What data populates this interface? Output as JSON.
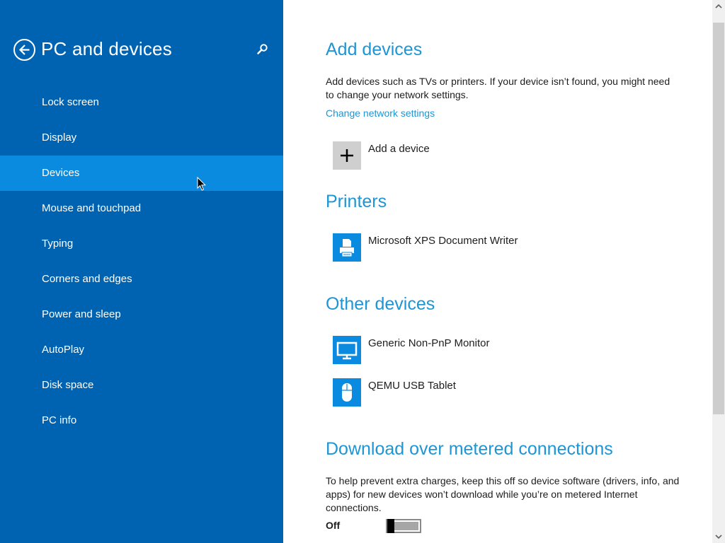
{
  "sidebar": {
    "title": "PC and devices",
    "items": [
      {
        "label": "Lock screen"
      },
      {
        "label": "Display"
      },
      {
        "label": "Devices"
      },
      {
        "label": "Mouse and touchpad"
      },
      {
        "label": "Typing"
      },
      {
        "label": "Corners and edges"
      },
      {
        "label": "Power and sleep"
      },
      {
        "label": "AutoPlay"
      },
      {
        "label": "Disk space"
      },
      {
        "label": "PC info"
      }
    ],
    "selected_item": "Devices",
    "background_color": "#0063b1",
    "selected_color": "#0a8be0"
  },
  "add_devices": {
    "title": "Add devices",
    "description": "Add devices such as TVs or printers. If your device isn’t found, you might need to change your network settings.",
    "link": "Change network settings",
    "add_button_label": "Add a device"
  },
  "printers": {
    "title": "Printers",
    "items": [
      {
        "label": "Microsoft XPS Document Writer",
        "icon": "printer-icon"
      }
    ]
  },
  "other_devices": {
    "title": "Other devices",
    "items": [
      {
        "label": "Generic Non-PnP Monitor",
        "icon": "monitor-icon"
      },
      {
        "label": "QEMU USB Tablet",
        "icon": "mouse-icon"
      }
    ]
  },
  "metered": {
    "title": "Download over metered connections",
    "description": "To help prevent extra charges, keep this off so device software (drivers, info, and apps) for new devices won’t download while you’re on metered Internet connections.",
    "toggle_label": "Off",
    "toggle_state": "off"
  },
  "colors": {
    "accent": "#1e95d4",
    "text": "#1d1d1d"
  }
}
